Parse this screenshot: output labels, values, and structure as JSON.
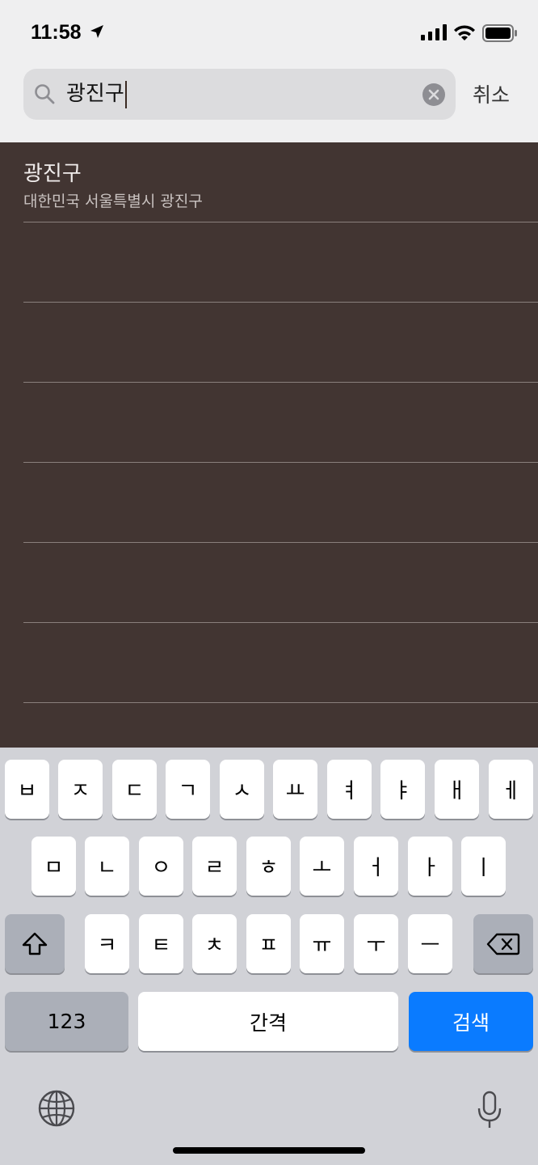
{
  "status_bar": {
    "time": "11:58"
  },
  "search": {
    "query": "광진구",
    "cancel_label": "취소"
  },
  "results": [
    {
      "title": "광진구",
      "subtitle": "대한민국 서울특별시 광진구"
    }
  ],
  "keyboard": {
    "row1": [
      "ㅂ",
      "ㅈ",
      "ㄷ",
      "ㄱ",
      "ㅅ",
      "ㅛ",
      "ㅕ",
      "ㅑ",
      "ㅐ",
      "ㅔ"
    ],
    "row2": [
      "ㅁ",
      "ㄴ",
      "ㅇ",
      "ㄹ",
      "ㅎ",
      "ㅗ",
      "ㅓ",
      "ㅏ",
      "ㅣ"
    ],
    "row3": [
      "ㅋ",
      "ㅌ",
      "ㅊ",
      "ㅍ",
      "ㅠ",
      "ㅜ",
      "ㅡ"
    ],
    "numbers_label": "123",
    "space_label": "간격",
    "search_label": "검색"
  },
  "colors": {
    "accent": "#0a7bff",
    "results_bg": "#423532"
  }
}
